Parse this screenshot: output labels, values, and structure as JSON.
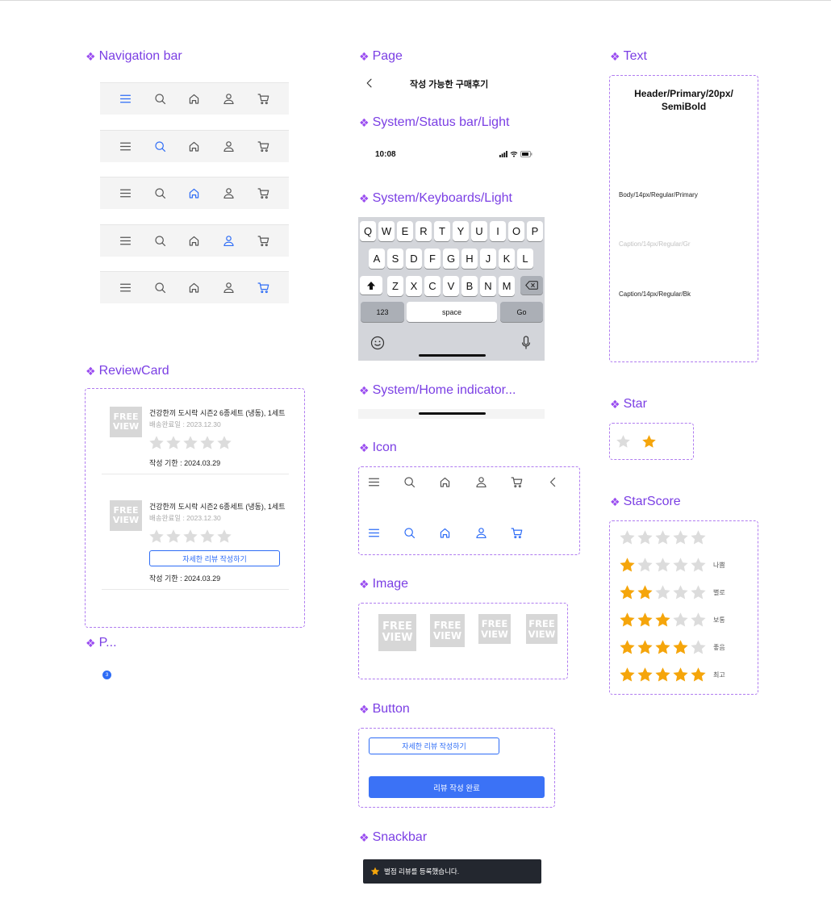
{
  "sections": {
    "navigation_bar": "Navigation bar",
    "review_card": "ReviewCard",
    "p": "P...",
    "page": "Page",
    "status_bar": "System/Status bar/Light",
    "keyboards": "System/Keyboards/Light",
    "home_indicator": "System/Home indicator...",
    "icon": "Icon",
    "image": "Image",
    "button": "Button",
    "snackbar": "Snackbar",
    "text": "Text",
    "star": "Star",
    "star_score": "StarScore"
  },
  "colors": {
    "accent": "#7b3fe4",
    "primary": "#2d6cf6",
    "star": "#f5a50b",
    "star_empty": "#dcdcdc",
    "snackbar_bg": "#23272f"
  },
  "navbar": {
    "icons": [
      "menu-icon",
      "search-icon",
      "home-icon",
      "user-icon",
      "cart-icon"
    ],
    "active_indices": [
      0,
      1,
      2,
      3,
      4
    ]
  },
  "review_card": {
    "items": [
      {
        "thumb_line1": "FREE",
        "thumb_line2": "VIEW",
        "title": "건강한끼 도시락 시즌2 6종세트 (냉동), 1세트",
        "delivered": "배송완료일 : 2023.12.30",
        "rating": 0,
        "due": "작성 기한 : 2024.03.29",
        "button": ""
      },
      {
        "thumb_line1": "FREE",
        "thumb_line2": "VIEW",
        "title": "건강한끼 도시락 시즌2 6종세트 (냉동), 1세트",
        "delivered": "배송완료일 : 2023.12.30",
        "rating": 0,
        "due": "작성 기한 : 2024.03.29",
        "button": "자세한 리뷰 작성하기"
      }
    ]
  },
  "pagination": {
    "badge": "3"
  },
  "page": {
    "title": "작성 가능한 구매후기",
    "back_icon": "chevron-left-icon"
  },
  "status_bar": {
    "time": "10:08"
  },
  "keyboard": {
    "row1": [
      "Q",
      "W",
      "E",
      "R",
      "T",
      "Y",
      "U",
      "I",
      "O",
      "P"
    ],
    "row2": [
      "A",
      "S",
      "D",
      "F",
      "G",
      "H",
      "J",
      "K",
      "L"
    ],
    "row3": [
      "Z",
      "X",
      "C",
      "V",
      "B",
      "N",
      "M"
    ],
    "num_key": "123",
    "space_key": "space",
    "go_key": "Go"
  },
  "icons_section": {
    "row1": [
      "menu-icon",
      "search-icon",
      "home-icon",
      "user-icon",
      "cart-icon",
      "chevron-left-icon"
    ],
    "row2": [
      "menu-icon",
      "search-icon",
      "home-icon",
      "user-icon",
      "cart-icon"
    ]
  },
  "images": {
    "line1": "FREE",
    "line2": "VIEW"
  },
  "buttons": {
    "outline": "자세한 리뷰 작성하기",
    "filled": "리뷰 작성 완료"
  },
  "snackbar": {
    "message": "별점 리뷰를 등록했습니다."
  },
  "text_styles": {
    "header": "Header/Primary/20px/\nSemiBold",
    "body": "Body/14px/Regular/Primary",
    "caption_gray": "Caption/14px/Regular/Gr",
    "caption_black": "Caption/14px/Regular/Bk"
  },
  "star_score": {
    "rows": [
      {
        "filled": 0,
        "label": ""
      },
      {
        "filled": 1,
        "label": "나쁨"
      },
      {
        "filled": 2,
        "label": "별로"
      },
      {
        "filled": 3,
        "label": "보통"
      },
      {
        "filled": 4,
        "label": "좋음"
      },
      {
        "filled": 5,
        "label": "최고"
      }
    ]
  }
}
